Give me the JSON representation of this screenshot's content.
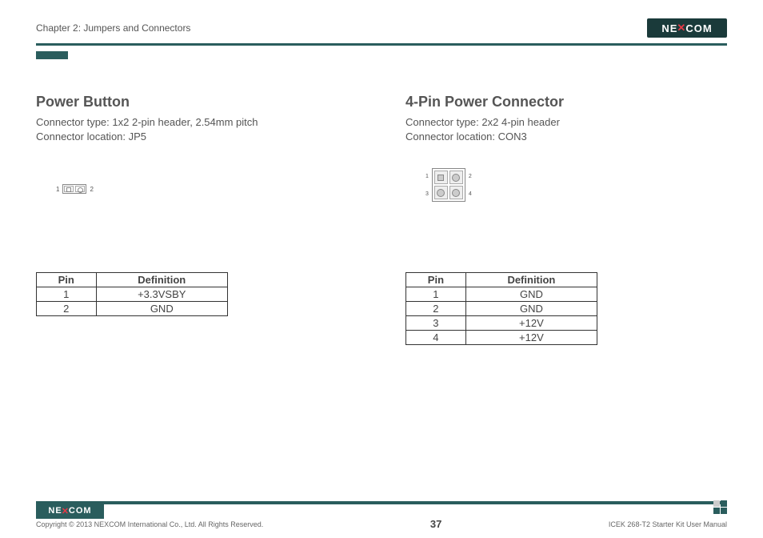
{
  "header": {
    "chapter": "Chapter 2: Jumpers and Connectors",
    "brand": "NEXCOM"
  },
  "left": {
    "title": "Power Button",
    "line1": "Connector type: 1x2 2-pin header, 2.54mm pitch",
    "line2": "Connector location: JP5",
    "diagram": {
      "label_left": "1",
      "label_right": "2"
    },
    "table": {
      "head_pin": "Pin",
      "head_def": "Definition",
      "rows": [
        {
          "pin": "1",
          "def": "+3.3VSBY"
        },
        {
          "pin": "2",
          "def": "GND"
        }
      ]
    }
  },
  "right": {
    "title": "4-Pin Power Connector",
    "line1": "Connector type: 2x2 4-pin header",
    "line2": "Connector location: CON3",
    "diagram": {
      "l1": "1",
      "l2": "2",
      "l3": "3",
      "l4": "4"
    },
    "table": {
      "head_pin": "Pin",
      "head_def": "Definition",
      "rows": [
        {
          "pin": "1",
          "def": "GND"
        },
        {
          "pin": "2",
          "def": "GND"
        },
        {
          "pin": "3",
          "def": "+12V"
        },
        {
          "pin": "4",
          "def": "+12V"
        }
      ]
    }
  },
  "footer": {
    "copyright": "Copyright © 2013 NEXCOM International Co., Ltd. All Rights Reserved.",
    "page": "37",
    "doc": "ICEK 268-T2 Starter Kit User Manual",
    "brand": "NEXCOM"
  }
}
